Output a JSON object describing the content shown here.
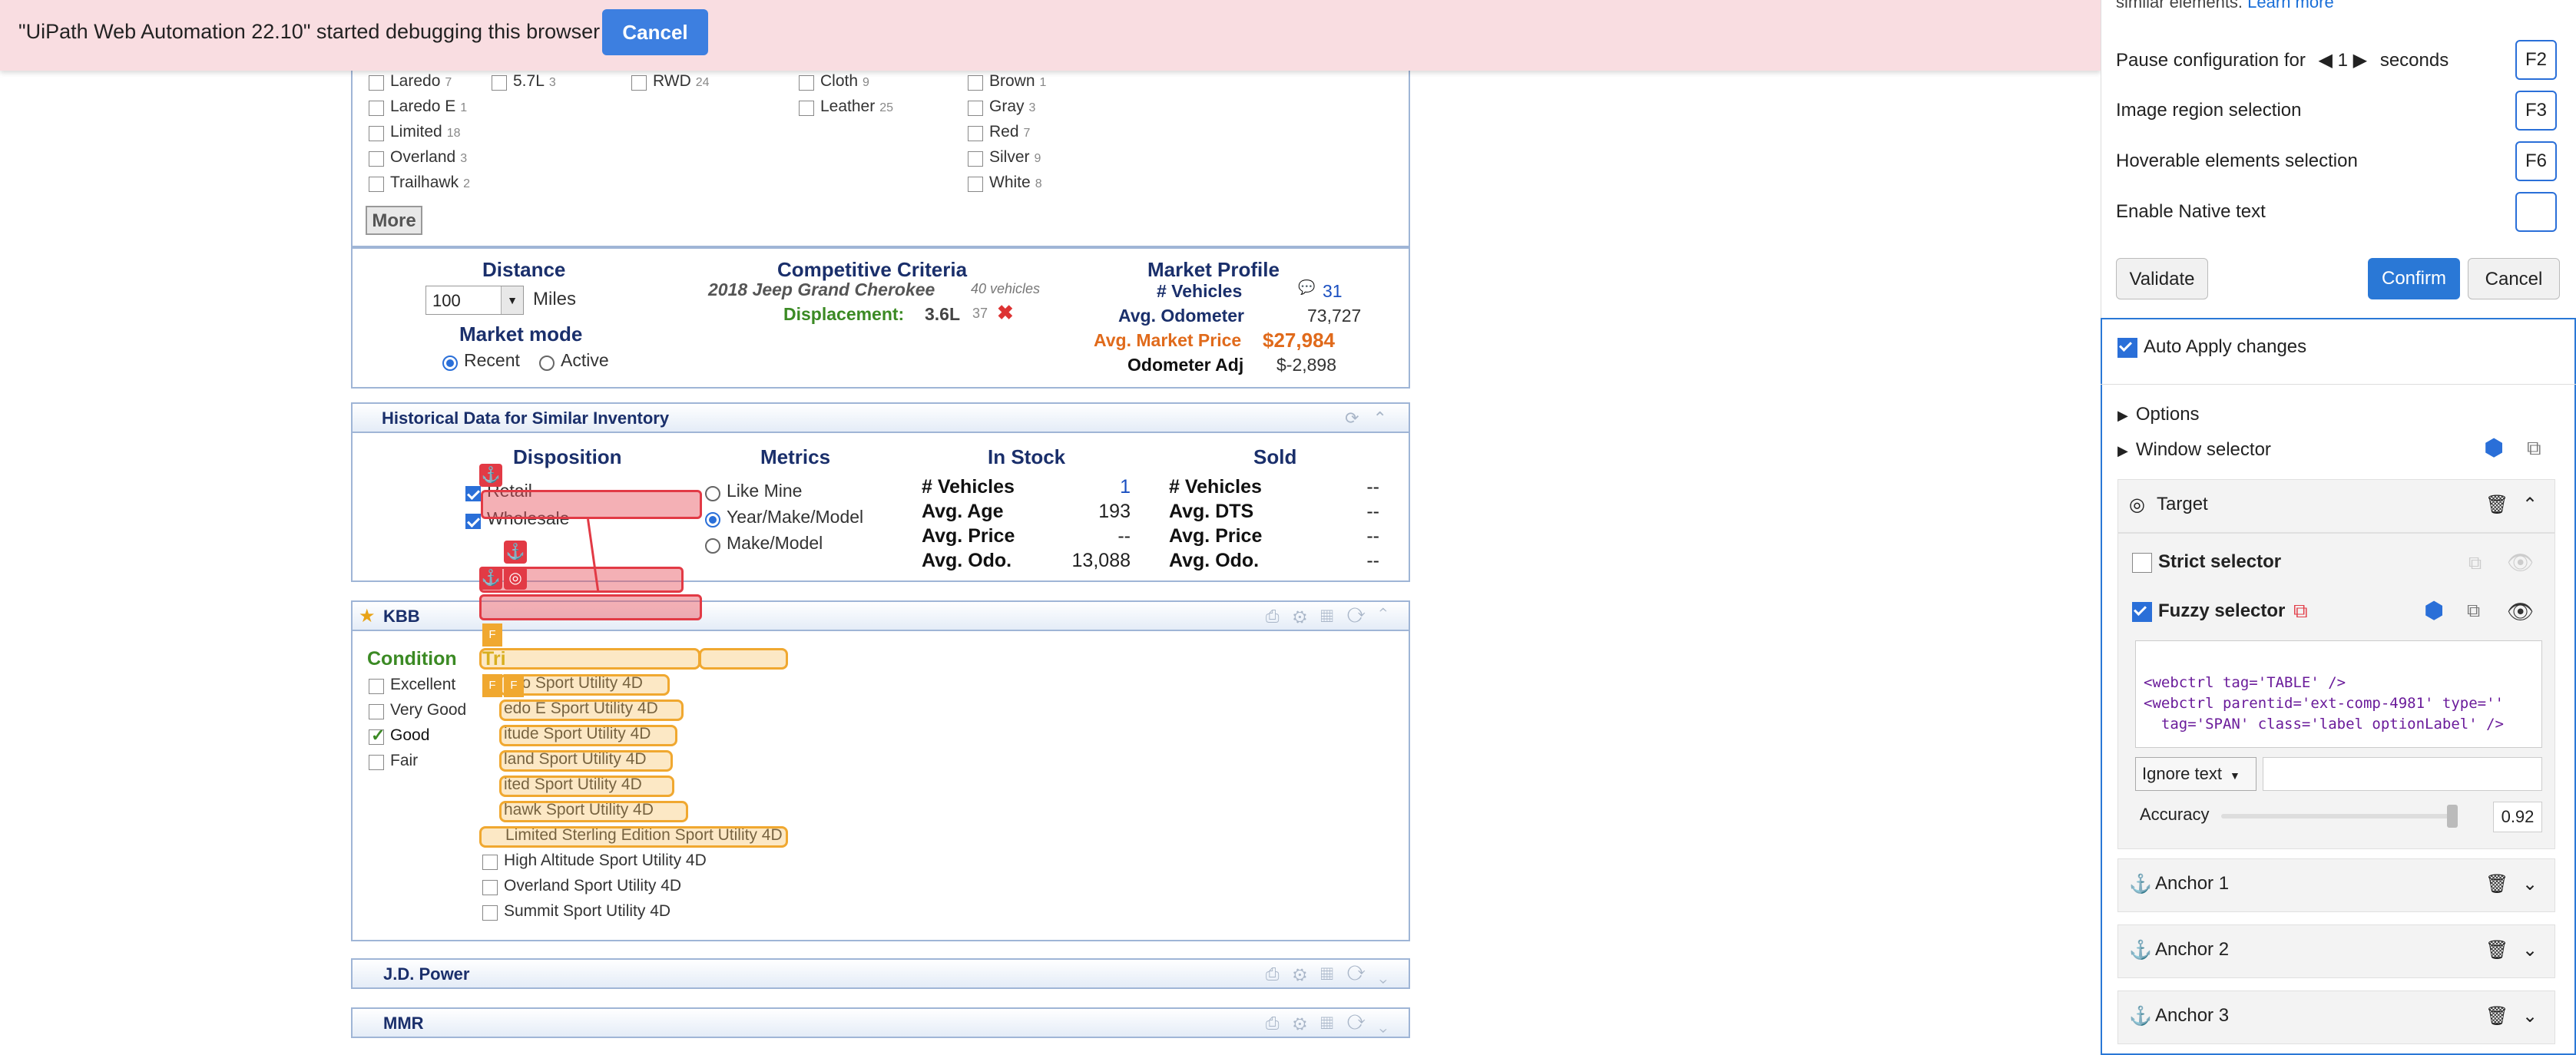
{
  "debug_bar": {
    "message": "\"UiPath Web Automation 22.10\" started debugging this browser",
    "cancel_label": "Cancel"
  },
  "filters": {
    "trim": [
      {
        "label": "Laredo",
        "count": "7"
      },
      {
        "label": "Laredo E",
        "count": "1"
      },
      {
        "label": "Limited",
        "count": "18"
      },
      {
        "label": "Overland",
        "count": "3"
      },
      {
        "label": "Trailhawk",
        "count": "2"
      }
    ],
    "engine": [
      {
        "label": "5.7L",
        "count": "3"
      }
    ],
    "drive": [
      {
        "label": "RWD",
        "count": "24"
      }
    ],
    "interior": [
      {
        "label": "Cloth",
        "count": "9"
      },
      {
        "label": "Leather",
        "count": "25"
      }
    ],
    "color": [
      {
        "label": "Brown",
        "count": "1"
      },
      {
        "label": "Gray",
        "count": "3"
      },
      {
        "label": "Red",
        "count": "7"
      },
      {
        "label": "Silver",
        "count": "9"
      },
      {
        "label": "White",
        "count": "8"
      }
    ],
    "more_label": "More"
  },
  "criteria": {
    "distance_title": "Distance",
    "distance_value": "100",
    "distance_unit": "Miles",
    "market_mode_title": "Market mode",
    "mode_recent": "Recent",
    "mode_active": "Active",
    "competitive_title": "Competitive Criteria",
    "vehicle": "2018 Jeep Grand Cherokee",
    "vehicle_count": "40 vehicles",
    "displacement_label": "Displacement:",
    "displacement_value": "3.6L",
    "displacement_count": "37",
    "market_profile_title": "Market Profile",
    "vehicles_label": "# Vehicles",
    "vehicles_value": "31",
    "odometer_label": "Avg. Odometer",
    "odometer_value": "73,727",
    "price_label": "Avg. Market Price",
    "price_value": "$27,984",
    "odoadj_label": "Odometer Adj",
    "odoadj_value": "$-2,898"
  },
  "historical": {
    "title": "Historical Data for Similar Inventory",
    "disposition_title": "Disposition",
    "retail": "Retail",
    "wholesale": "Wholesale",
    "metrics_title": "Metrics",
    "like_mine": "Like Mine",
    "ymm": "Year/Make/Model",
    "make_model": "Make/Model",
    "instock_title": "In Stock",
    "sold_title": "Sold",
    "instock": [
      {
        "label": "# Vehicles",
        "value": "1"
      },
      {
        "label": "Avg. Age",
        "value": "193"
      },
      {
        "label": "Avg. Price",
        "value": "--"
      },
      {
        "label": "Avg. Odo.",
        "value": "13,088"
      }
    ],
    "sold": [
      {
        "label": "# Vehicles",
        "value": "--"
      },
      {
        "label": "Avg. DTS",
        "value": "--"
      },
      {
        "label": "Avg. Price",
        "value": "--"
      },
      {
        "label": "Avg. Odo.",
        "value": "--"
      }
    ]
  },
  "kbb": {
    "title": "KBB",
    "condition_title": "Condition",
    "conditions": [
      "Excellent",
      "Very Good",
      "Good",
      "Fair"
    ],
    "trim_head": "Tri",
    "trims": [
      "edo Sport Utility 4D",
      "edo E Sport Utility 4D",
      "itude Sport Utility 4D",
      "land Sport Utility 4D",
      "ited Sport Utility 4D",
      "hawk Sport Utility 4D",
      "Limited Sterling Edition Sport Utility 4D",
      "High Altitude Sport Utility 4D",
      "Overland Sport Utility 4D",
      "Summit Sport Utility 4D"
    ],
    "tag_letter": "F"
  },
  "jdpower": {
    "title": "J.D. Power"
  },
  "mmr": {
    "title": "MMR"
  },
  "right_panel": {
    "top_text": "similar elements.",
    "learn_more": "Learn more",
    "pause_pre": "Pause configuration for",
    "pause_value": "1",
    "pause_post": "seconds",
    "pause_key": "F2",
    "image_region": "Image region selection",
    "image_key": "F3",
    "hoverable": "Hoverable elements selection",
    "hover_key": "F6",
    "native_text": "Enable Native text",
    "validate": "Validate",
    "confirm": "Confirm",
    "cancel": "Cancel",
    "auto_apply": "Auto Apply changes",
    "options": "Options",
    "window_selector": "Window selector",
    "target": "Target",
    "strict_selector": "Strict selector",
    "fuzzy_selector": "Fuzzy selector",
    "selector_line1": "<webctrl tag='TABLE' />",
    "selector_line2": "<webctrl parentid='ext-comp-4981' type=''",
    "selector_line3": "  tag='SPAN' class='label optionLabel' />",
    "ignore_text": "Ignore text",
    "accuracy_label": "Accuracy",
    "accuracy_value": "0.92",
    "anchors": [
      "Anchor  1",
      "Anchor  2",
      "Anchor  3"
    ]
  },
  "colors": {
    "accent": "#3d7fe0",
    "navy": "#1a2f6b",
    "overlay_red": "#e23a45",
    "overlay_orange": "#f0a830",
    "banner": "#f9dde1"
  }
}
